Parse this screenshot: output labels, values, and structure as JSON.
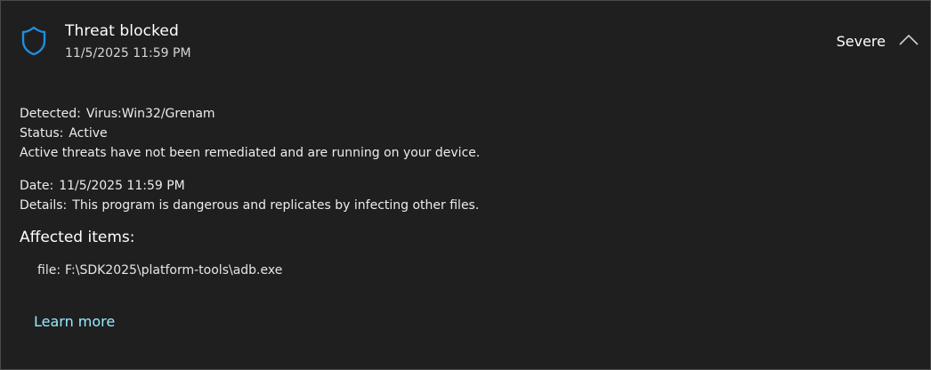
{
  "threat": {
    "title": "Threat blocked",
    "timestamp": "11/5/2025 11:59 PM",
    "severity": "Severe",
    "icon": "shield-icon",
    "collapse_icon": "chevron-up-icon"
  },
  "details": {
    "detected_label": "Detected:",
    "detected_value": "Virus:Win32/Grenam",
    "status_label": "Status:",
    "status_value": "Active",
    "status_message": "Active threats have not been remediated and are running on your device.",
    "date_label": "Date:",
    "date_value": "11/5/2025 11:59 PM",
    "details_label": "Details:",
    "details_value": "This program is dangerous and replicates by infecting other files."
  },
  "affected": {
    "title": "Affected items:",
    "items": [
      {
        "type_label": "file:",
        "path": "F:\\SDK2025\\platform-tools\\adb.exe"
      }
    ]
  },
  "links": {
    "learn_more": "Learn more"
  },
  "colors": {
    "background": "#1f1f1f",
    "border": "#4a4a4a",
    "accent": "#1d8fe1",
    "link": "#99ebff"
  }
}
